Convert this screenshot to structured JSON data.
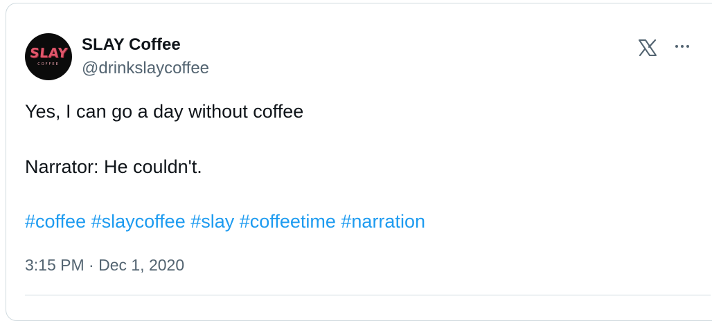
{
  "author": {
    "display_name": "SLAY Coffee",
    "handle": "@drinkslaycoffee",
    "avatar_logo_text": "SLAY",
    "avatar_sub_text": "COFFEE"
  },
  "tweet": {
    "line1": "Yes, I can go a day without coffee",
    "line2": "Narrator: He couldn't.",
    "hashtags": [
      "#coffee",
      "#slaycoffee",
      "#slay",
      "#coffeetime",
      "#narration"
    ]
  },
  "meta": {
    "timestamp": "3:15 PM · Dec 1, 2020"
  },
  "icons": {
    "brand": "x-logo-icon",
    "menu": "more-options-icon"
  },
  "colors": {
    "link": "#1d9bf0",
    "secondary_text": "#536471",
    "primary_text": "#0f1419",
    "border": "#cfd9de",
    "avatar_accent": "#e0566b"
  }
}
